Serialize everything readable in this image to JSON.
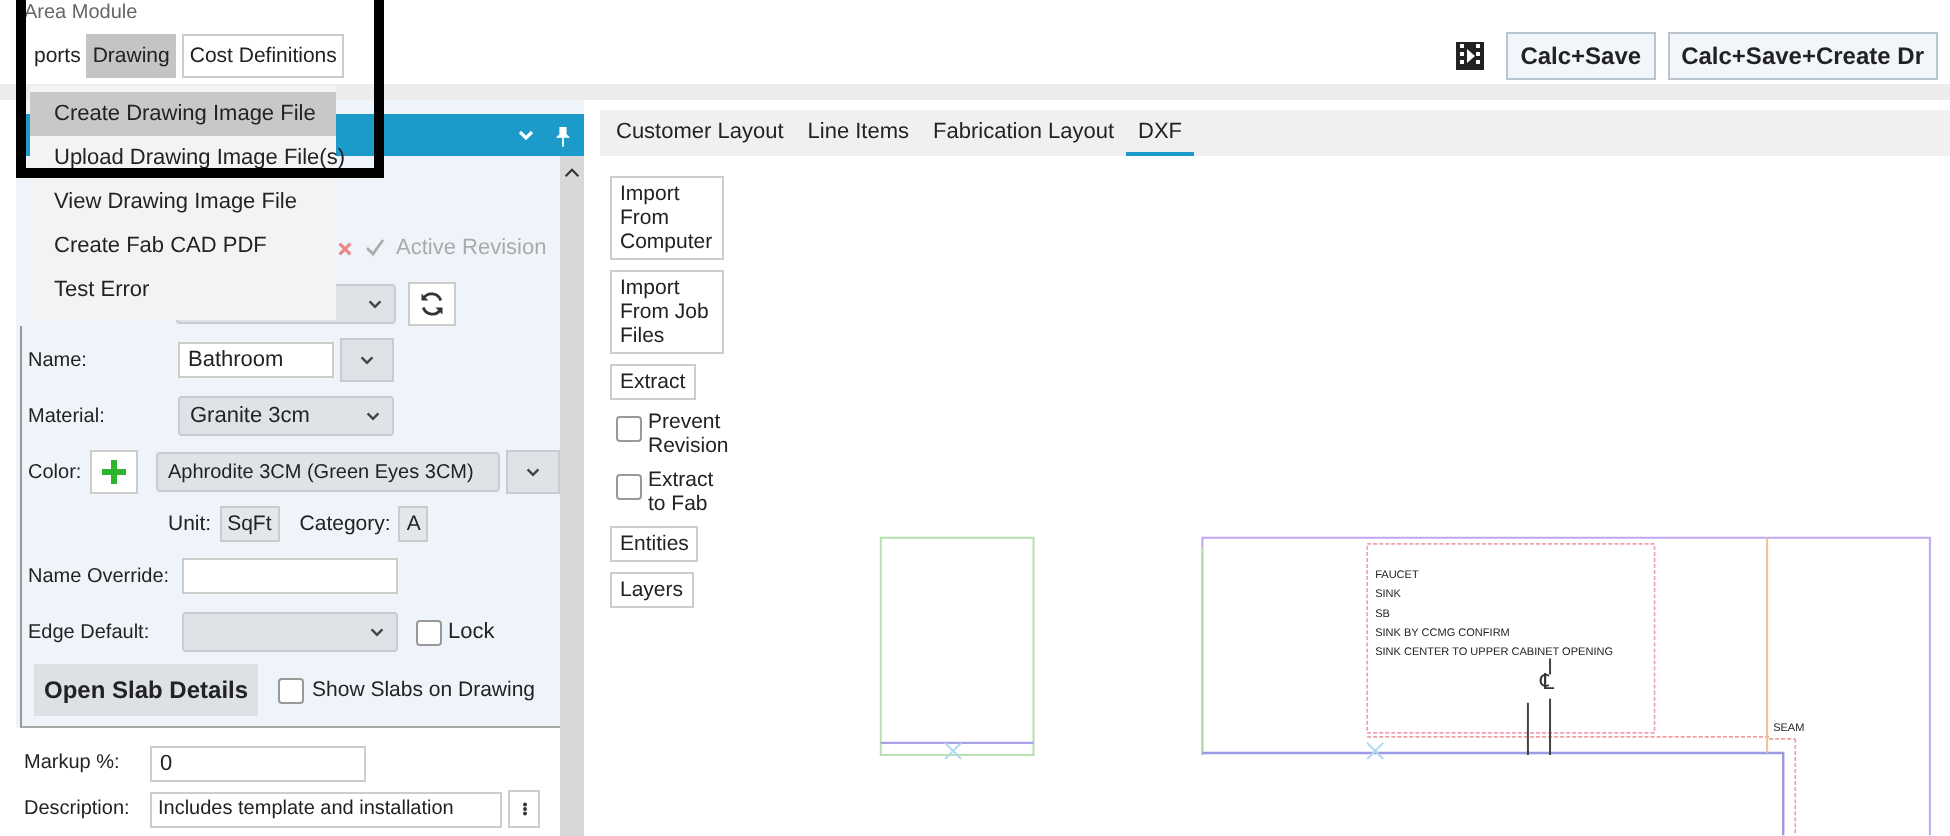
{
  "window": {
    "title": "Area Module"
  },
  "menu_bar": [
    {
      "label": "ports",
      "kind": "menu",
      "selected": false
    },
    {
      "label": "Drawing",
      "kind": "menu",
      "selected": true
    },
    {
      "label": "Cost Definitions",
      "kind": "button",
      "selected": false
    }
  ],
  "drawing_menu": [
    {
      "label": "Create Drawing Image File",
      "highlighted": true
    },
    {
      "label": "Upload Drawing Image File(s)",
      "highlighted": false
    },
    {
      "label": "View Drawing Image File",
      "highlighted": false
    },
    {
      "label": "Create Fab CAD PDF",
      "highlighted": false
    },
    {
      "label": "Test Error",
      "highlighted": false
    }
  ],
  "toolbar": {
    "buttons": [
      "Calc+Save",
      "Calc+Save+Create Dr"
    ]
  },
  "left_panel": {
    "revision": {
      "label": "Active Revision",
      "disabled": true
    },
    "form": {
      "name": {
        "label": "Name:",
        "value": "Bathroom"
      },
      "material": {
        "label": "Material:",
        "value": "Granite 3cm"
      },
      "color": {
        "label": "Color:",
        "value": "Aphrodite 3CM (Green Eyes 3CM)"
      },
      "unit": {
        "label": "Unit:",
        "value": "SqFt"
      },
      "category": {
        "label": "Category:",
        "value": "A"
      },
      "name_override": {
        "label": "Name Override:"
      },
      "edge_default": {
        "label": "Edge Default:"
      },
      "lock": {
        "label": "Lock",
        "checked": false
      },
      "open_slab_button": "Open Slab Details",
      "show_slabs": {
        "label": "Show Slabs on Drawing",
        "checked": false
      },
      "markup": {
        "label": "Markup %:",
        "value": "0"
      },
      "description": {
        "label": "Description:",
        "value": "Includes template and installation"
      }
    }
  },
  "tabs": [
    {
      "label": "Customer Layout",
      "selected": false
    },
    {
      "label": "Line Items",
      "selected": false
    },
    {
      "label": "Fabrication Layout",
      "selected": false
    },
    {
      "label": "DXF",
      "selected": true
    }
  ],
  "dxf_tools": [
    {
      "kind": "button",
      "label": "Import From Computer"
    },
    {
      "kind": "button",
      "label": "Import From Job Files"
    },
    {
      "kind": "button",
      "label": "Extract"
    },
    {
      "kind": "checkbox",
      "label": "Prevent Revision",
      "checked": false
    },
    {
      "kind": "checkbox",
      "label": "Extract to Fab",
      "checked": false
    },
    {
      "kind": "button",
      "label": "Entities"
    },
    {
      "kind": "button",
      "label": "Layers"
    }
  ],
  "drawing_notes": [
    "FAUCET",
    "SINK",
    "SB",
    "SINK BY CCMG CONFIRM",
    "SINK CENTER TO UPPER CABINET OPENING"
  ],
  "seam_label": "SEAM",
  "centerline_mark": "℄"
}
